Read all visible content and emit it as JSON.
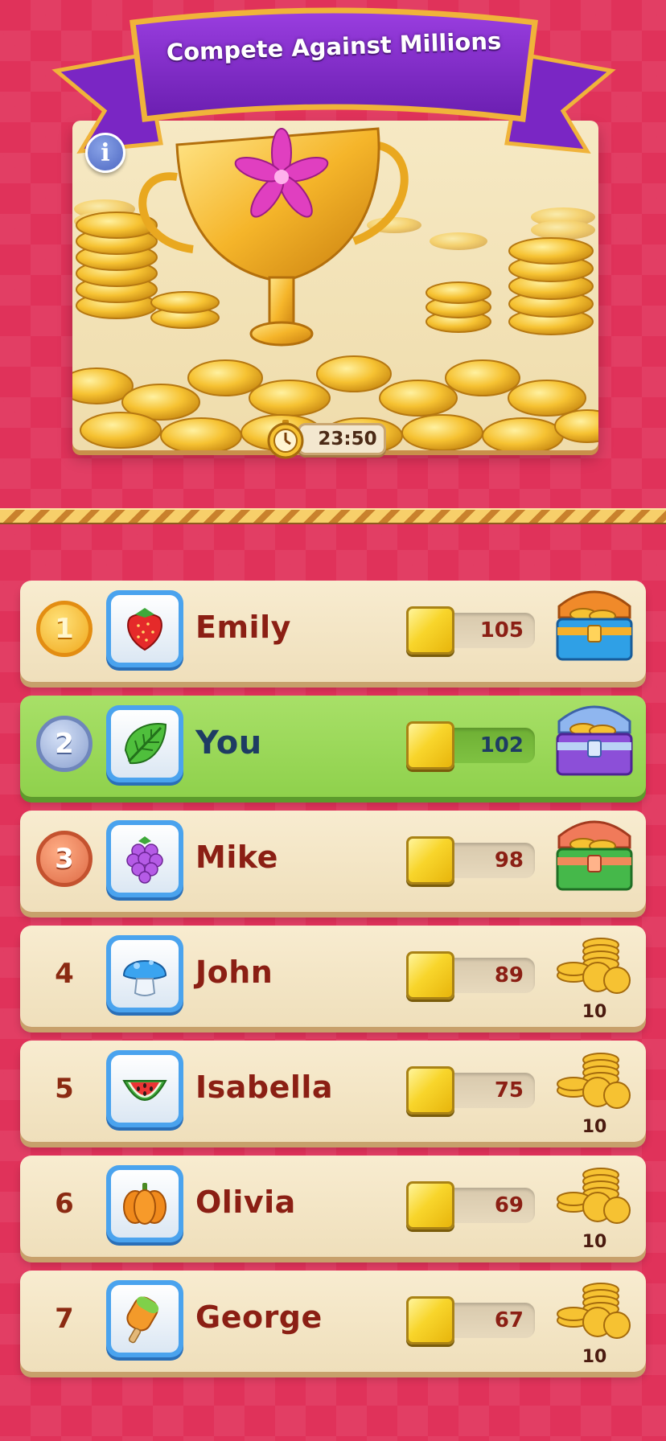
{
  "header": {
    "title": "Compete Against Millions",
    "info_label": "i",
    "timer": "23:50"
  },
  "colors": {
    "background": "#e0325a",
    "highlight_row": "#8fd14c",
    "name_text": "#8b1f14",
    "you_text": "#1e3c63"
  },
  "leaderboard": [
    {
      "rank": "1",
      "medal": "gold",
      "avatar": "strawberry-icon",
      "name": "Emily",
      "score": "105",
      "reward": "gold-chest-icon",
      "reward_count": ""
    },
    {
      "rank": "2",
      "medal": "silver",
      "avatar": "leaf-icon",
      "name": "You",
      "score": "102",
      "reward": "silver-chest-icon",
      "reward_count": "",
      "highlight": true
    },
    {
      "rank": "3",
      "medal": "bronze",
      "avatar": "blackberry-icon",
      "name": "Mike",
      "score": "98",
      "reward": "bronze-chest-icon",
      "reward_count": ""
    },
    {
      "rank": "4",
      "medal": "",
      "avatar": "mushroom-icon",
      "name": "John",
      "score": "89",
      "reward": "coin-stack-icon",
      "reward_count": "10"
    },
    {
      "rank": "5",
      "medal": "",
      "avatar": "watermelon-icon",
      "name": "Isabella",
      "score": "75",
      "reward": "coin-stack-icon",
      "reward_count": "10"
    },
    {
      "rank": "6",
      "medal": "",
      "avatar": "pumpkin-icon",
      "name": "Olivia",
      "score": "69",
      "reward": "coin-stack-icon",
      "reward_count": "10"
    },
    {
      "rank": "7",
      "medal": "",
      "avatar": "popsicle-icon",
      "name": "George",
      "score": "67",
      "reward": "coin-stack-icon",
      "reward_count": "10"
    }
  ]
}
